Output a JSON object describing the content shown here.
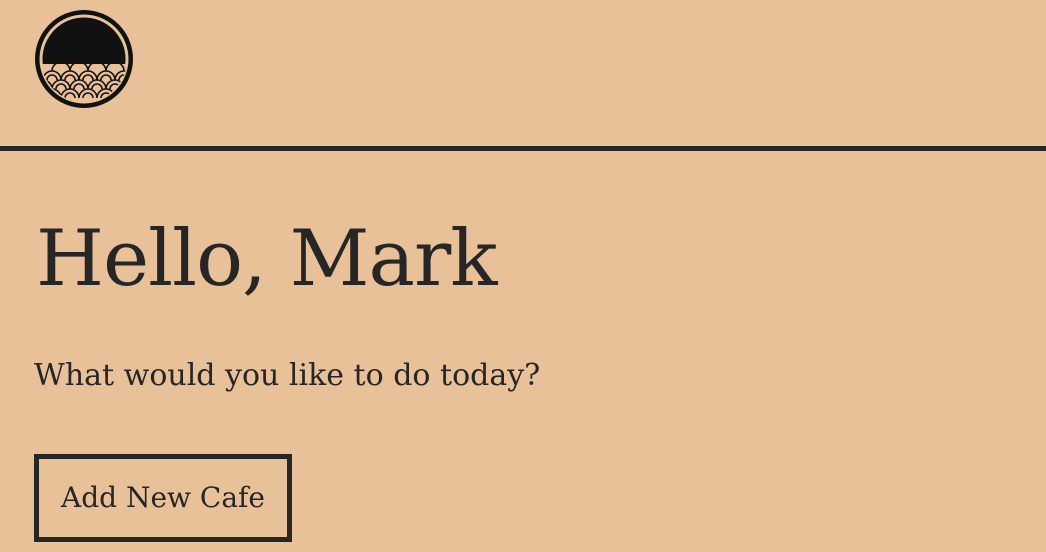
{
  "header": {
    "logo_icon": "wave-circle-logo-icon"
  },
  "main": {
    "greeting": "Hello, Mark",
    "prompt": "What would you like to do today?",
    "add_cafe_label": "Add New Cafe"
  },
  "colors": {
    "background": "#E8C199",
    "ink": "#262626"
  }
}
